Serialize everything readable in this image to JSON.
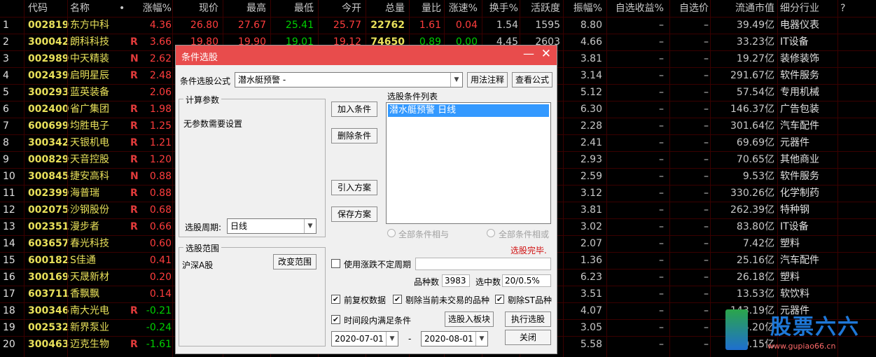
{
  "table": {
    "headers": [
      "代码",
      "名称",
      "•",
      "涨幅%",
      "现价",
      "最高",
      "最低",
      "今开",
      "总量",
      "量比",
      "涨速%",
      "换手%",
      "活跃度",
      "振幅%",
      "自选收益%",
      "自选价",
      "流通市值",
      "细分行业",
      "?"
    ],
    "rows": [
      {
        "idx": "1",
        "code": "002819",
        "name": "东方中科",
        "flag": "",
        "chg": "4.36",
        "price": "26.80",
        "high": "27.67",
        "low": "25.41",
        "open": "25.77",
        "vol": "22762",
        "vr": "1.61",
        "spd": "0.04",
        "turn": "1.54",
        "act": "1595",
        "amp": "8.80",
        "ret": "–",
        "sp": "–",
        "mcap": "39.49亿",
        "ind": "电器仪表"
      },
      {
        "idx": "2",
        "code": "300042",
        "name": "朗科科技",
        "flag": "R",
        "chg": "3.66",
        "price": "19.80",
        "high": "19.90",
        "low": "19.01",
        "open": "19.12",
        "vol": "74650",
        "vr": "0.89",
        "spd": "0.00",
        "turn": "4.45",
        "act": "2603",
        "amp": "4.66",
        "ret": "–",
        "sp": "–",
        "mcap": "33.23亿",
        "ind": "IT设备"
      },
      {
        "idx": "3",
        "code": "002989",
        "name": "中天精装",
        "flag": "N",
        "chg": "2.62",
        "price": "",
        "high": "",
        "low": "",
        "open": "",
        "vol": "",
        "vr": "",
        "spd": "",
        "turn": "",
        "act": "",
        "amp": "3.81",
        "ret": "–",
        "sp": "–",
        "mcap": "19.27亿",
        "ind": "装修装饰"
      },
      {
        "idx": "4",
        "code": "002439",
        "name": "启明星辰",
        "flag": "R",
        "chg": "2.48",
        "price": "",
        "high": "",
        "low": "",
        "open": "",
        "vol": "",
        "vr": "",
        "spd": "",
        "turn": "",
        "act": "",
        "amp": "3.14",
        "ret": "–",
        "sp": "–",
        "mcap": "291.67亿",
        "ind": "软件服务"
      },
      {
        "idx": "5",
        "code": "300293",
        "name": "蓝英装备",
        "flag": "",
        "chg": "2.06",
        "price": "",
        "high": "",
        "low": "",
        "open": "",
        "vol": "",
        "vr": "",
        "spd": "",
        "turn": "",
        "act": "",
        "amp": "5.12",
        "ret": "–",
        "sp": "–",
        "mcap": "57.54亿",
        "ind": "专用机械"
      },
      {
        "idx": "6",
        "code": "002400",
        "name": "省广集团",
        "flag": "R",
        "chg": "1.98",
        "price": "",
        "high": "",
        "low": "",
        "open": "",
        "vol": "",
        "vr": "",
        "spd": "",
        "turn": "",
        "act": "",
        "amp": "6.30",
        "ret": "–",
        "sp": "–",
        "mcap": "146.37亿",
        "ind": "广告包装"
      },
      {
        "idx": "7",
        "code": "600699",
        "name": "均胜电子",
        "flag": "R",
        "chg": "1.25",
        "price": "",
        "high": "",
        "low": "",
        "open": "",
        "vol": "",
        "vr": "",
        "spd": "",
        "turn": "",
        "act": "",
        "amp": "2.28",
        "ret": "–",
        "sp": "–",
        "mcap": "301.64亿",
        "ind": "汽车配件"
      },
      {
        "idx": "8",
        "code": "300342",
        "name": "天银机电",
        "flag": "R",
        "chg": "1.21",
        "price": "",
        "high": "",
        "low": "",
        "open": "",
        "vol": "",
        "vr": "",
        "spd": "",
        "turn": "",
        "act": "",
        "amp": "2.41",
        "ret": "–",
        "sp": "–",
        "mcap": "69.69亿",
        "ind": "元器件"
      },
      {
        "idx": "9",
        "code": "000829",
        "name": "天音控股",
        "flag": "R",
        "chg": "1.20",
        "price": "",
        "high": "",
        "low": "",
        "open": "",
        "vol": "",
        "vr": "",
        "spd": "",
        "turn": "",
        "act": "",
        "amp": "2.93",
        "ret": "–",
        "sp": "–",
        "mcap": "70.65亿",
        "ind": "其他商业"
      },
      {
        "idx": "10",
        "code": "300845",
        "name": "捷安高科",
        "flag": "N",
        "chg": "0.88",
        "price": "",
        "high": "",
        "low": "",
        "open": "",
        "vol": "",
        "vr": "",
        "spd": "",
        "turn": "",
        "act": "",
        "amp": "2.59",
        "ret": "–",
        "sp": "–",
        "mcap": "9.53亿",
        "ind": "软件服务"
      },
      {
        "idx": "11",
        "code": "002399",
        "name": "海普瑞",
        "flag": "R",
        "chg": "0.88",
        "price": "",
        "high": "",
        "low": "",
        "open": "",
        "vol": "",
        "vr": "",
        "spd": "",
        "turn": "",
        "act": "",
        "amp": "3.12",
        "ret": "–",
        "sp": "–",
        "mcap": "330.26亿",
        "ind": "化学制药"
      },
      {
        "idx": "12",
        "code": "002075",
        "name": "沙钢股份",
        "flag": "R",
        "chg": "0.68",
        "price": "",
        "high": "",
        "low": "",
        "open": "",
        "vol": "",
        "vr": "",
        "spd": "",
        "turn": "",
        "act": "",
        "amp": "3.81",
        "ret": "–",
        "sp": "–",
        "mcap": "262.39亿",
        "ind": "特种钢"
      },
      {
        "idx": "13",
        "code": "002351",
        "name": "漫步者",
        "flag": "R",
        "chg": "0.66",
        "price": "",
        "high": "",
        "low": "",
        "open": "",
        "vol": "",
        "vr": "",
        "spd": "",
        "turn": "",
        "act": "",
        "amp": "3.02",
        "ret": "–",
        "sp": "–",
        "mcap": "83.80亿",
        "ind": "IT设备"
      },
      {
        "idx": "14",
        "code": "603657",
        "name": "春光科技",
        "flag": "",
        "chg": "0.60",
        "price": "",
        "high": "",
        "low": "",
        "open": "",
        "vol": "",
        "vr": "",
        "spd": "",
        "turn": "",
        "act": "",
        "amp": "2.07",
        "ret": "–",
        "sp": "–",
        "mcap": "7.42亿",
        "ind": "塑料"
      },
      {
        "idx": "15",
        "code": "600182",
        "name": "S佳通",
        "flag": "",
        "chg": "0.41",
        "price": "",
        "high": "",
        "low": "",
        "open": "",
        "vol": "",
        "vr": "",
        "spd": "",
        "turn": "",
        "act": "",
        "amp": "1.36",
        "ret": "–",
        "sp": "–",
        "mcap": "25.16亿",
        "ind": "汽车配件"
      },
      {
        "idx": "16",
        "code": "300169",
        "name": "天晟新材",
        "flag": "",
        "chg": "0.20",
        "price": "",
        "high": "",
        "low": "",
        "open": "",
        "vol": "",
        "vr": "",
        "spd": "",
        "turn": "",
        "act": "",
        "amp": "6.23",
        "ret": "–",
        "sp": "–",
        "mcap": "26.18亿",
        "ind": "塑料"
      },
      {
        "idx": "17",
        "code": "603711",
        "name": "香飘飘",
        "flag": "",
        "chg": "0.14",
        "price": "",
        "high": "",
        "low": "",
        "open": "",
        "vol": "",
        "vr": "",
        "spd": "",
        "turn": "",
        "act": "",
        "amp": "3.51",
        "ret": "–",
        "sp": "–",
        "mcap": "13.53亿",
        "ind": "软饮料"
      },
      {
        "idx": "18",
        "code": "300346",
        "name": "南大光电",
        "flag": "R",
        "chg": "-0.21",
        "price": "",
        "high": "",
        "low": "",
        "open": "",
        "vol": "",
        "vr": "",
        "spd": "",
        "turn": "",
        "act": "",
        "amp": "4.07",
        "ret": "–",
        "sp": "–",
        "mcap": "143.19亿",
        "ind": "元器件"
      },
      {
        "idx": "19",
        "code": "002532",
        "name": "新界泵业",
        "flag": "",
        "chg": "-0.24",
        "price": "",
        "high": "",
        "low": "",
        "open": "",
        "vol": "",
        "vr": "",
        "spd": "",
        "turn": "",
        "act": "",
        "amp": "3.05",
        "ret": "–",
        "sp": "–",
        "mcap": "35.20亿",
        "ind": ""
      },
      {
        "idx": "20",
        "code": "300463",
        "name": "迈克生物",
        "flag": "R",
        "chg": "-1.61",
        "price": "",
        "high": "",
        "low": "",
        "open": "",
        "vol": "",
        "vr": "",
        "spd": "",
        "turn": "",
        "act": "",
        "amp": "5.58",
        "ret": "–",
        "sp": "–",
        "mcap": "210.15亿",
        "ind": ""
      }
    ]
  },
  "dialog": {
    "title": "条件选股",
    "formula_label": "条件选股公式",
    "formula_value": "潜水艇预警  -",
    "usage_btn": "用法注释",
    "view_btn": "查看公式",
    "calc_params_title": "计算参数",
    "no_params": "无参数需要设置",
    "period_label": "选股周期:",
    "period_value": "日线",
    "add_btn": "加入条件",
    "delete_btn": "删除条件",
    "import_btn": "引入方案",
    "save_btn": "保存方案",
    "list_title": "选股条件列表",
    "list_item": "潜水艇预警  日线",
    "radio_and": "全部条件相与",
    "radio_or": "全部条件相或",
    "status": "选股完毕.",
    "range_title": "选股范围",
    "range_value": "沪深A股",
    "change_range_btn": "改变范围",
    "use_uncertain": "使用涨跌不定周期",
    "total_label": "品种数",
    "total_value": "3983",
    "selected_label": "选中数",
    "selected_value": "20/0.5%",
    "adj_label": "前复权数据",
    "excl_notrade": "剔除当前未交易的品种",
    "excl_st": "剔除ST品种",
    "time_range": "时间段内满足条件",
    "to_block_btn": "选股入板块",
    "run_btn": "执行选股",
    "date_from": "2020-07-01",
    "date_sep": "-",
    "date_to": "2020-08-01",
    "close_btn": "关闭"
  },
  "watermark": {
    "title": "股票六六",
    "sub": "www.gupiao66.cn"
  },
  "colors": {
    "accent": "#e84c4c",
    "up": "#ff3d3d",
    "down": "#00d000",
    "code": "#e8e05a"
  }
}
